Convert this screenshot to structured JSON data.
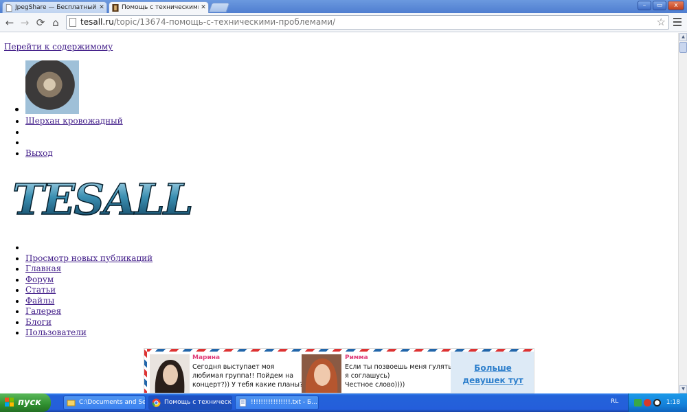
{
  "browser": {
    "tabs": [
      {
        "title": "JpegShare — Бесплатный х",
        "active": false
      },
      {
        "title": "Помощь с техническими пр",
        "active": true
      }
    ],
    "url_host": "tesall.ru",
    "url_path": "/topic/13674-помощь-с-техническими-проблемами/",
    "window_buttons": {
      "minimize": "–",
      "maximize": "▭",
      "close": "x"
    }
  },
  "page": {
    "skip_link": "Перейти к содержимому",
    "user_links": [
      {
        "label": "Шерхан кровожадный "
      },
      {
        "label": " "
      },
      {
        "label": " "
      },
      {
        "label": "Выход"
      }
    ],
    "nav_links": [
      {
        "label": " "
      },
      {
        "label": "Просмотр новых публикаций"
      },
      {
        "label": "Главная"
      },
      {
        "label": "Форум"
      },
      {
        "label": "Статьи"
      },
      {
        "label": "Файлы"
      },
      {
        "label": "Галерея"
      },
      {
        "label": "Блоги"
      },
      {
        "label": "Пользователи"
      }
    ],
    "logo_text": "TESALL"
  },
  "ad": {
    "profiles": [
      {
        "name": "Марина",
        "message": [
          "Сегодня выступает моя",
          "любимая группа!! Пойдем на",
          "концерт?)) У тебя какие планы?"
        ]
      },
      {
        "name": "Римма",
        "message": [
          "Если ты позвоешь меня гулять,",
          "я соглашусь)",
          "Честное слово))))"
        ]
      }
    ],
    "more_link": [
      "Больше",
      "девушек тут"
    ]
  },
  "taskbar": {
    "start_label": "пуск",
    "tasks": [
      {
        "label": "C:\\Documents and Se...",
        "active": false
      },
      {
        "label": "Помощь с техническ...",
        "active": true
      },
      {
        "label": "!!!!!!!!!!!!!!!!.txt - Б...",
        "active": false
      }
    ],
    "language": "RL",
    "clock": "1:18"
  }
}
